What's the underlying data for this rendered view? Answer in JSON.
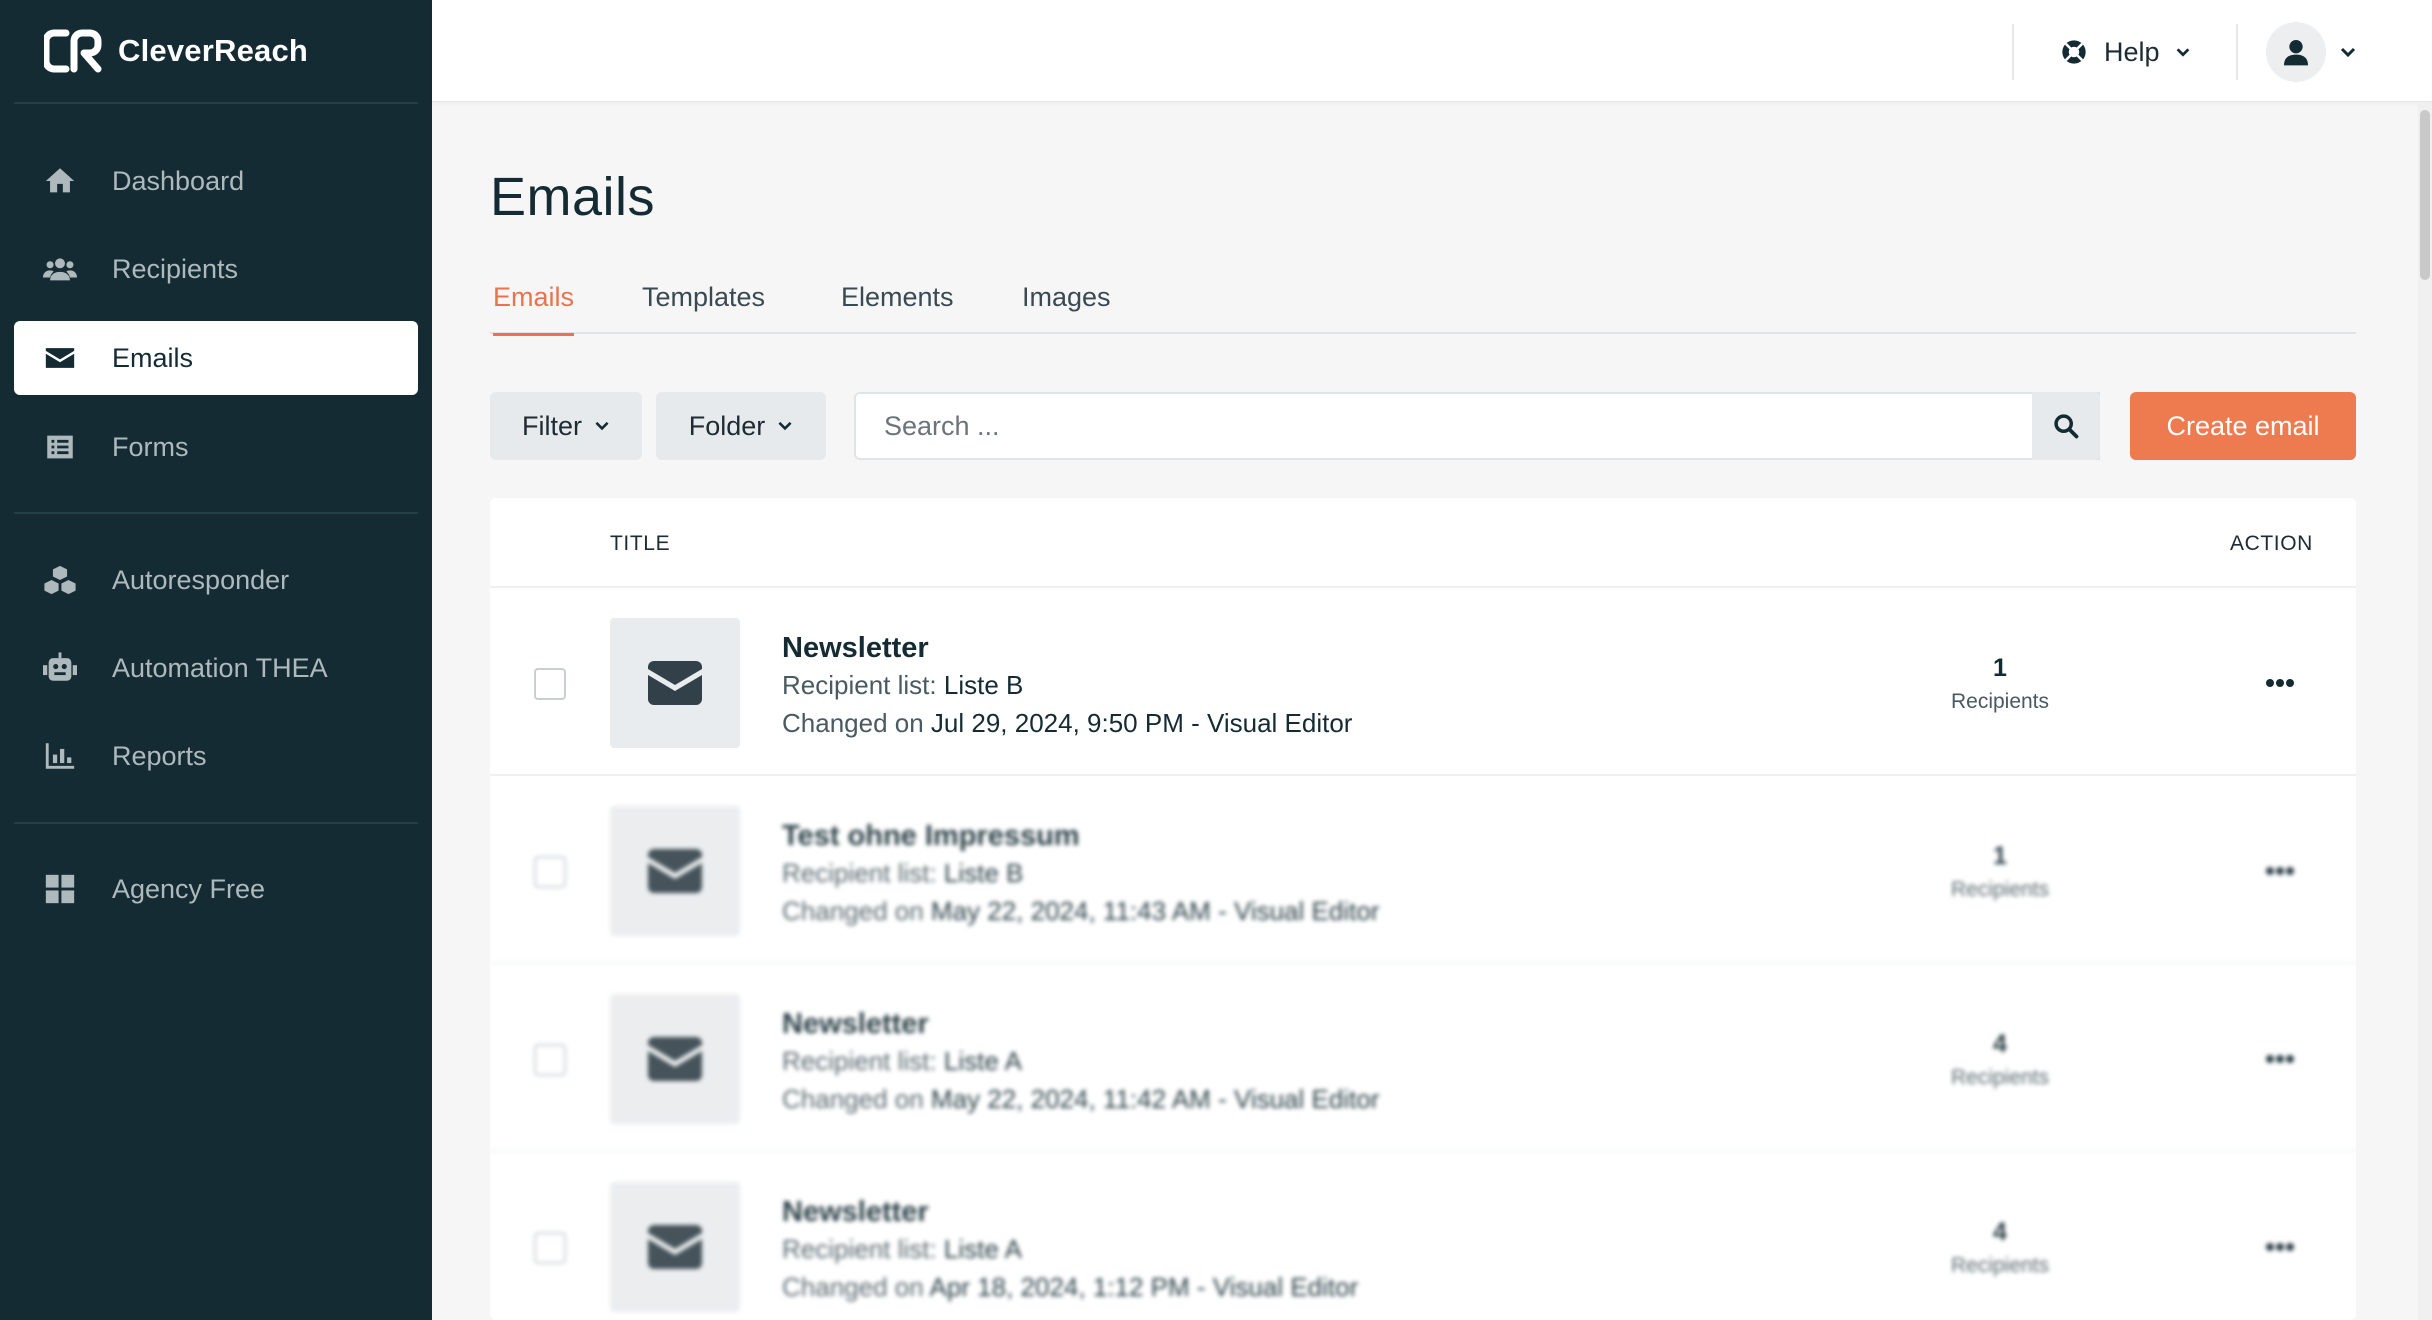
{
  "app": {
    "brand": "CleverReach"
  },
  "sidebar": {
    "items": [
      {
        "label": "Dashboard",
        "icon": "home-icon"
      },
      {
        "label": "Recipients",
        "icon": "users-icon"
      },
      {
        "label": "Emails",
        "icon": "envelope-icon",
        "active": true
      },
      {
        "label": "Forms",
        "icon": "form-icon"
      },
      {
        "label": "Autoresponder",
        "icon": "cubes-icon"
      },
      {
        "label": "Automation THEA",
        "icon": "robot-icon"
      },
      {
        "label": "Reports",
        "icon": "bar-chart-icon"
      },
      {
        "label": "Agency Free",
        "icon": "grid-icon"
      }
    ]
  },
  "topbar": {
    "help_label": "Help"
  },
  "page": {
    "title": "Emails"
  },
  "tabs": [
    {
      "label": "Emails",
      "active": true
    },
    {
      "label": "Templates"
    },
    {
      "label": "Elements"
    },
    {
      "label": "Images"
    }
  ],
  "toolbar": {
    "filter_label": "Filter",
    "folder_label": "Folder",
    "search_placeholder": "Search ...",
    "create_label": "Create email"
  },
  "table": {
    "col_title": "TITLE",
    "col_action": "ACTION",
    "rows": [
      {
        "title": "Newsletter",
        "list_prefix": "Recipient list:",
        "list": "Liste B",
        "changed_prefix": "Changed on",
        "changed": "Jul 29, 2024, 9:50 PM - Visual Editor",
        "count": "1",
        "count_label": "Recipients"
      },
      {
        "title": "Test ohne Impressum",
        "list_prefix": "Recipient list:",
        "list": "Liste B",
        "changed_prefix": "Changed on",
        "changed": "May 22, 2024, 11:43 AM - Visual Editor",
        "count": "1",
        "count_label": "Recipients"
      },
      {
        "title": "Newsletter",
        "list_prefix": "Recipient list:",
        "list": "Liste A",
        "changed_prefix": "Changed on",
        "changed": "May 22, 2024, 11:42 AM - Visual Editor",
        "count": "4",
        "count_label": "Recipients"
      },
      {
        "title": "Newsletter",
        "list_prefix": "Recipient list:",
        "list": "Liste A",
        "changed_prefix": "Changed on",
        "changed": "Apr 18, 2024, 1:12 PM - Visual Editor",
        "count": "4",
        "count_label": "Recipients"
      }
    ]
  },
  "colors": {
    "sidebar_bg": "#142b33",
    "accent": "#ee7a50",
    "page_bg": "#f6f6f7"
  }
}
